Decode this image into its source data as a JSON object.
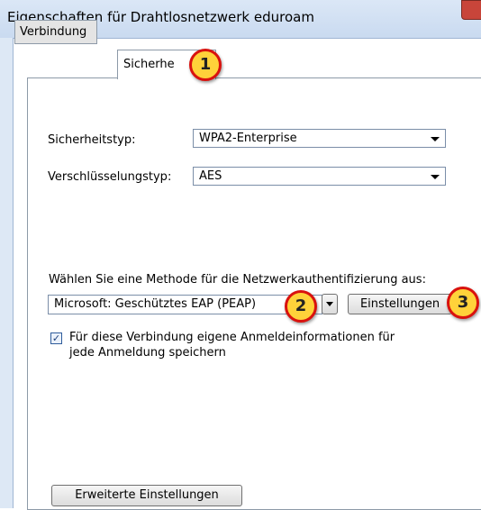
{
  "window": {
    "title": "Eigenschaften für Drahtlosnetzwerk eduroam"
  },
  "tabs": [
    {
      "label": "Verbindung"
    },
    {
      "label": "Sicherhe"
    }
  ],
  "security": {
    "type_label": "Sicherheitstyp:",
    "type_value": "WPA2-Enterprise",
    "encryption_label": "Verschlüsselungstyp:",
    "encryption_value": "AES"
  },
  "auth": {
    "prompt": "Wählen Sie eine Methode für die Netzwerkauthentifizierung aus:",
    "method_value": "Microsoft: Geschütztes EAP (PEAP)",
    "settings_button": "Einstellungen",
    "remember_checked": true,
    "remember_line1": "Für diese Verbindung eigene Anmeldeinformationen für",
    "remember_line2": "jede Anmeldung speichern"
  },
  "advanced_button": "Erweiterte Einstellungen",
  "annotations": [
    "1",
    "2",
    "3"
  ],
  "colors": {
    "badge_fill": "#ffd23a",
    "badge_border": "#d9120e"
  }
}
